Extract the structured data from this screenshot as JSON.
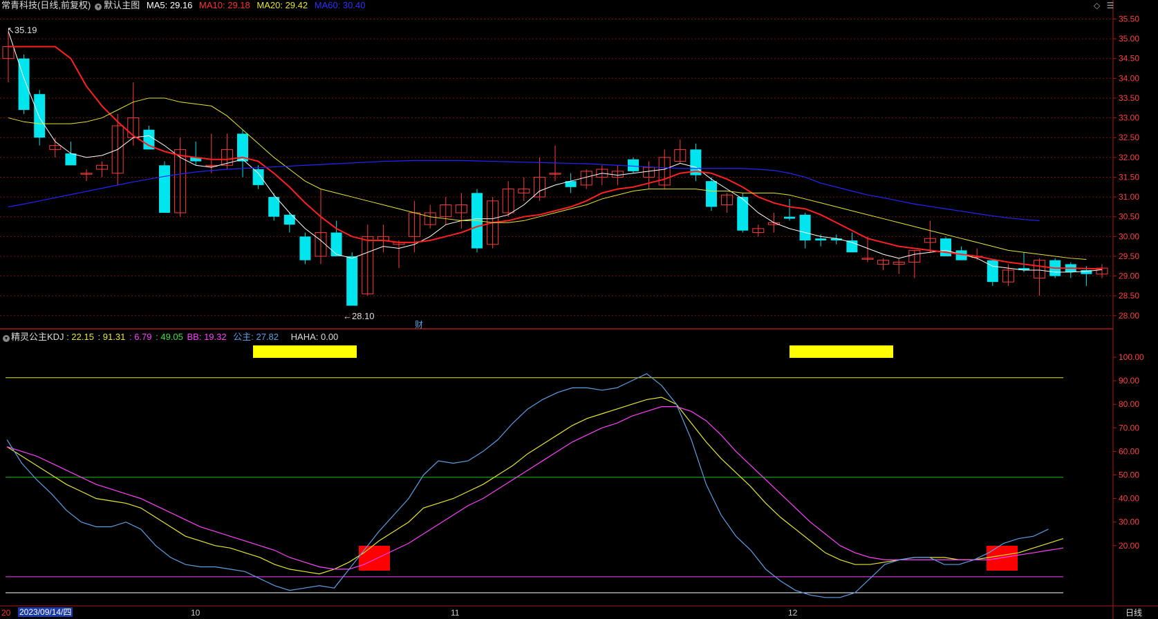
{
  "main_header": {
    "title": "常青科技(日线,前复权)",
    "layout": "默认主图",
    "ma5": "MA5: 29.16",
    "ma10": "MA10: 29.18",
    "ma20": "MA20: 29.42",
    "ma60": "MA60: 30.40"
  },
  "kdj_header": {
    "title": "精灵公主KDJ",
    "v1": ": 22.15",
    "v2": ": 91.31",
    "v3": ": 6.79",
    "v4": ": 49.05",
    "bb": "BB: 19.32",
    "gz": "公主: 27.82",
    "haha": "HAHA: 0.00"
  },
  "annotations": {
    "high": "35.19",
    "low": "28.10",
    "finance_marker": "财"
  },
  "date_axis": {
    "cursor_date": "2023/09/14/四",
    "left_label": "20",
    "months": [
      "10",
      "11",
      "12"
    ],
    "period": "日线"
  },
  "colors": {
    "bg": "#000000",
    "up": "#ff3b3b",
    "down": "#00e5ee",
    "ma5": "#ffffff",
    "ma10": "#ff2020",
    "ma20": "#e6e62e",
    "ma60": "#2424ff",
    "grid": "#7a1010",
    "k": "#e6e62e",
    "d": "#ff40ff",
    "j": "#5aa0e6"
  },
  "chart_data": [
    {
      "type": "candlestick",
      "title": "常青科技(日线,前复权)",
      "ylim": [
        27.7,
        35.7
      ],
      "y_ticks": [
        "35.50",
        "35.00",
        "34.50",
        "34.00",
        "33.50",
        "33.00",
        "32.50",
        "32.00",
        "31.50",
        "31.00",
        "30.50",
        "30.00",
        "29.50",
        "29.00",
        "28.50",
        "28.00"
      ],
      "candles": [
        {
          "o": 34.5,
          "h": 35.19,
          "l": 33.9,
          "c": 34.8
        },
        {
          "o": 34.5,
          "h": 34.6,
          "l": 33.1,
          "c": 33.2
        },
        {
          "o": 33.6,
          "h": 33.7,
          "l": 32.3,
          "c": 32.5
        },
        {
          "o": 32.2,
          "h": 32.5,
          "l": 32.0,
          "c": 32.3
        },
        {
          "o": 32.1,
          "h": 32.4,
          "l": 31.8,
          "c": 31.8
        },
        {
          "o": 31.6,
          "h": 31.7,
          "l": 31.4,
          "c": 31.6
        },
        {
          "o": 31.7,
          "h": 31.9,
          "l": 31.5,
          "c": 31.8
        },
        {
          "o": 31.6,
          "h": 33.1,
          "l": 31.3,
          "c": 32.8
        },
        {
          "o": 32.5,
          "h": 33.9,
          "l": 32.3,
          "c": 33.0
        },
        {
          "o": 32.7,
          "h": 32.8,
          "l": 32.2,
          "c": 32.2
        },
        {
          "o": 31.8,
          "h": 31.9,
          "l": 30.6,
          "c": 30.6
        },
        {
          "o": 30.6,
          "h": 32.5,
          "l": 30.5,
          "c": 32.2
        },
        {
          "o": 32.0,
          "h": 32.4,
          "l": 31.8,
          "c": 31.9
        },
        {
          "o": 31.8,
          "h": 32.6,
          "l": 31.6,
          "c": 31.8
        },
        {
          "o": 31.8,
          "h": 32.6,
          "l": 31.7,
          "c": 32.2
        },
        {
          "o": 32.6,
          "h": 32.7,
          "l": 31.5,
          "c": 31.9
        },
        {
          "o": 31.7,
          "h": 31.8,
          "l": 31.2,
          "c": 31.3
        },
        {
          "o": 31.0,
          "h": 31.1,
          "l": 30.4,
          "c": 30.5
        },
        {
          "o": 30.55,
          "h": 30.6,
          "l": 30.1,
          "c": 30.3
        },
        {
          "o": 30.0,
          "h": 30.1,
          "l": 29.3,
          "c": 29.4
        },
        {
          "o": 29.5,
          "h": 31.2,
          "l": 29.3,
          "c": 30.1
        },
        {
          "o": 30.1,
          "h": 30.4,
          "l": 29.5,
          "c": 29.5
        },
        {
          "o": 29.5,
          "h": 29.6,
          "l": 28.3,
          "c": 28.25
        },
        {
          "o": 28.55,
          "h": 30.3,
          "l": 28.5,
          "c": 30.0
        },
        {
          "o": 29.9,
          "h": 30.3,
          "l": 29.6,
          "c": 30.0
        },
        {
          "o": 29.8,
          "h": 29.9,
          "l": 29.2,
          "c": 29.85
        },
        {
          "o": 30.0,
          "h": 30.9,
          "l": 29.6,
          "c": 30.6
        },
        {
          "o": 30.3,
          "h": 30.8,
          "l": 30.2,
          "c": 30.6
        },
        {
          "o": 30.5,
          "h": 31.0,
          "l": 30.3,
          "c": 30.8
        },
        {
          "o": 30.6,
          "h": 31.1,
          "l": 30.2,
          "c": 30.8
        },
        {
          "o": 31.1,
          "h": 31.2,
          "l": 29.6,
          "c": 29.7
        },
        {
          "o": 29.8,
          "h": 31.0,
          "l": 29.7,
          "c": 30.9
        },
        {
          "o": 30.6,
          "h": 31.4,
          "l": 30.5,
          "c": 31.2
        },
        {
          "o": 31.1,
          "h": 31.5,
          "l": 30.9,
          "c": 31.2
        },
        {
          "o": 31.0,
          "h": 32.0,
          "l": 30.9,
          "c": 31.5
        },
        {
          "o": 31.6,
          "h": 32.3,
          "l": 31.4,
          "c": 31.6
        },
        {
          "o": 31.4,
          "h": 31.6,
          "l": 31.1,
          "c": 31.25
        },
        {
          "o": 31.3,
          "h": 31.7,
          "l": 31.2,
          "c": 31.65
        },
        {
          "o": 31.5,
          "h": 31.8,
          "l": 31.3,
          "c": 31.7
        },
        {
          "o": 31.5,
          "h": 31.8,
          "l": 31.3,
          "c": 31.65
        },
        {
          "o": 31.95,
          "h": 32.0,
          "l": 31.6,
          "c": 31.65
        },
        {
          "o": 31.5,
          "h": 31.9,
          "l": 31.2,
          "c": 31.75
        },
        {
          "o": 31.3,
          "h": 32.2,
          "l": 31.2,
          "c": 32.0
        },
        {
          "o": 31.9,
          "h": 32.45,
          "l": 31.85,
          "c": 32.2
        },
        {
          "o": 32.2,
          "h": 32.35,
          "l": 31.4,
          "c": 31.55
        },
        {
          "o": 31.4,
          "h": 31.5,
          "l": 30.65,
          "c": 30.75
        },
        {
          "o": 30.8,
          "h": 31.1,
          "l": 30.6,
          "c": 31.05
        },
        {
          "o": 31.0,
          "h": 31.1,
          "l": 30.1,
          "c": 30.15
        },
        {
          "o": 30.1,
          "h": 30.3,
          "l": 30.0,
          "c": 30.2
        },
        {
          "o": 30.3,
          "h": 30.6,
          "l": 30.1,
          "c": 30.35
        },
        {
          "o": 30.5,
          "h": 30.95,
          "l": 30.4,
          "c": 30.45
        },
        {
          "o": 30.55,
          "h": 30.6,
          "l": 29.7,
          "c": 29.9
        },
        {
          "o": 29.95,
          "h": 30.05,
          "l": 29.75,
          "c": 29.9
        },
        {
          "o": 29.95,
          "h": 30.05,
          "l": 29.8,
          "c": 29.9
        },
        {
          "o": 29.9,
          "h": 30.1,
          "l": 29.6,
          "c": 29.6
        },
        {
          "o": 29.45,
          "h": 30.0,
          "l": 29.35,
          "c": 29.45
        },
        {
          "o": 29.3,
          "h": 29.45,
          "l": 29.15,
          "c": 29.4
        },
        {
          "o": 29.3,
          "h": 29.45,
          "l": 29.05,
          "c": 29.35
        },
        {
          "o": 29.35,
          "h": 29.65,
          "l": 28.95,
          "c": 29.65
        },
        {
          "o": 29.85,
          "h": 30.4,
          "l": 29.6,
          "c": 29.95
        },
        {
          "o": 29.95,
          "h": 30.0,
          "l": 29.5,
          "c": 29.5
        },
        {
          "o": 29.65,
          "h": 29.75,
          "l": 29.4,
          "c": 29.4
        },
        {
          "o": 29.5,
          "h": 29.7,
          "l": 29.4,
          "c": 29.5
        },
        {
          "o": 29.4,
          "h": 29.4,
          "l": 28.75,
          "c": 28.85
        },
        {
          "o": 28.85,
          "h": 29.3,
          "l": 28.75,
          "c": 29.15
        },
        {
          "o": 29.2,
          "h": 29.6,
          "l": 29.1,
          "c": 29.15
        },
        {
          "o": 28.95,
          "h": 29.45,
          "l": 28.5,
          "c": 29.4
        },
        {
          "o": 29.4,
          "h": 29.45,
          "l": 28.95,
          "c": 29.0
        },
        {
          "o": 29.3,
          "h": 29.35,
          "l": 28.95,
          "c": 29.1
        },
        {
          "o": 29.15,
          "h": 29.25,
          "l": 28.75,
          "c": 29.05
        },
        {
          "o": 29.05,
          "h": 29.3,
          "l": 28.95,
          "c": 29.2
        }
      ],
      "ma_lines": {
        "ma5": [
          35.19,
          34.0,
          33.0,
          32.4,
          32.1,
          32.0,
          32.05,
          32.2,
          32.5,
          32.55,
          32.3,
          32.0,
          31.8,
          31.75,
          31.85,
          31.95,
          31.6,
          31.05,
          30.6,
          30.2,
          29.9,
          29.55,
          29.45,
          29.6,
          29.75,
          29.7,
          29.8,
          30.0,
          30.3,
          30.4,
          30.45,
          30.45,
          30.55,
          30.8,
          31.15,
          31.3,
          31.4,
          31.5,
          31.6,
          31.55,
          31.6,
          31.65,
          31.7,
          31.85,
          31.75,
          31.45,
          31.2,
          30.95,
          30.6,
          30.35,
          30.2,
          30.1,
          30.0,
          29.95,
          29.85,
          29.7,
          29.55,
          29.45,
          29.55,
          29.6,
          29.65,
          29.55,
          29.45,
          29.25,
          29.2,
          29.15,
          29.15,
          29.1,
          29.1,
          29.12,
          29.16
        ],
        "ma10": [
          34.8,
          34.8,
          34.8,
          34.8,
          34.5,
          33.8,
          33.3,
          32.9,
          32.55,
          32.3,
          32.15,
          32.05,
          32.0,
          31.95,
          31.95,
          32.0,
          31.9,
          31.6,
          31.25,
          30.85,
          30.5,
          30.2,
          30.0,
          29.9,
          29.9,
          29.85,
          29.85,
          29.9,
          30.0,
          30.1,
          30.25,
          30.35,
          30.4,
          30.5,
          30.55,
          30.65,
          30.75,
          30.9,
          31.1,
          31.2,
          31.25,
          31.35,
          31.45,
          31.6,
          31.65,
          31.6,
          31.45,
          31.25,
          31.0,
          30.85,
          30.75,
          30.7,
          30.55,
          30.35,
          30.15,
          29.95,
          29.85,
          29.75,
          29.7,
          29.65,
          29.6,
          29.55,
          29.5,
          29.42,
          29.35,
          29.3,
          29.25,
          29.2,
          29.2,
          29.19,
          29.18
        ],
        "ma20": [
          33.0,
          32.9,
          32.85,
          32.85,
          32.85,
          32.9,
          33.0,
          33.2,
          33.4,
          33.5,
          33.5,
          33.4,
          33.35,
          33.3,
          33.05,
          32.7,
          32.35,
          32.0,
          31.7,
          31.4,
          31.2,
          31.1,
          31.0,
          30.9,
          30.8,
          30.7,
          30.6,
          30.5,
          30.45,
          30.4,
          30.4,
          30.35,
          30.35,
          30.4,
          30.5,
          30.6,
          30.7,
          30.8,
          30.95,
          31.05,
          31.15,
          31.2,
          31.2,
          31.2,
          31.2,
          31.15,
          31.15,
          31.1,
          31.1,
          31.1,
          31.05,
          30.95,
          30.85,
          30.75,
          30.65,
          30.55,
          30.45,
          30.35,
          30.25,
          30.15,
          30.05,
          29.95,
          29.85,
          29.75,
          29.65,
          29.6,
          29.55,
          29.5,
          29.45,
          29.42
        ],
        "ma60": [
          30.75,
          30.82,
          30.9,
          30.98,
          31.06,
          31.14,
          31.22,
          31.3,
          31.38,
          31.45,
          31.52,
          31.58,
          31.63,
          31.67,
          31.7,
          31.72,
          31.74,
          31.76,
          31.78,
          31.8,
          31.82,
          31.84,
          31.86,
          31.88,
          31.9,
          31.91,
          31.92,
          31.92,
          31.92,
          31.92,
          31.91,
          31.9,
          31.89,
          31.88,
          31.87,
          31.86,
          31.85,
          31.84,
          31.82,
          31.8,
          31.78,
          31.76,
          31.74,
          31.72,
          31.72,
          31.72,
          31.72,
          31.72,
          31.7,
          31.67,
          31.6,
          31.5,
          31.35,
          31.25,
          31.15,
          31.05,
          30.98,
          30.9,
          30.82,
          30.76,
          30.7,
          30.64,
          30.58,
          30.52,
          30.47,
          30.43,
          30.4
        ]
      }
    },
    {
      "type": "line",
      "title": "精灵公主KDJ",
      "ylim": [
        0,
        105
      ],
      "y_ticks": [
        "100.00",
        "90.00",
        "80.00",
        "70.00",
        "60.00",
        "50.00",
        "40.00",
        "30.00",
        "20.00"
      ],
      "ref_lines": {
        "yellow": 91.3,
        "green": 49,
        "magenta": 6.8,
        "white": 0
      },
      "series": [
        {
          "name": "K",
          "values": [
            62,
            58,
            54,
            50,
            46,
            43,
            40,
            39,
            38,
            36,
            32,
            28,
            24,
            22,
            20,
            19,
            17,
            15,
            12,
            10,
            9,
            8,
            10,
            13,
            17,
            22,
            26,
            30,
            36,
            38,
            40,
            43,
            46,
            50,
            54,
            59,
            63,
            67,
            71,
            74,
            76,
            78,
            80,
            82,
            83,
            80,
            72,
            64,
            57,
            51,
            45,
            38,
            32,
            27,
            22,
            17,
            14,
            12,
            12,
            13,
            14,
            15,
            15,
            15,
            14,
            14,
            15,
            16,
            17,
            19,
            21,
            23
          ]
        },
        {
          "name": "D",
          "values": [
            62,
            60,
            58,
            55,
            52,
            49,
            46,
            44,
            42,
            40,
            37,
            34,
            31,
            28,
            26,
            24,
            22,
            20,
            18,
            15,
            13,
            11,
            10,
            10,
            12,
            15,
            18,
            21,
            25,
            29,
            33,
            37,
            40,
            44,
            48,
            52,
            56,
            60,
            64,
            67,
            70,
            72,
            75,
            77,
            79,
            79,
            77,
            73,
            67,
            60,
            54,
            48,
            42,
            36,
            30,
            25,
            20,
            17,
            15,
            14,
            14,
            14,
            14,
            14,
            14,
            14,
            14,
            15,
            16,
            17,
            18,
            19
          ]
        },
        {
          "name": "J",
          "values": [
            65,
            55,
            48,
            42,
            35,
            30,
            28,
            28,
            30,
            27,
            20,
            15,
            12,
            11,
            11,
            10,
            9,
            6,
            3,
            1,
            2,
            3,
            2,
            10,
            18,
            26,
            33,
            40,
            50,
            56,
            55,
            56,
            60,
            65,
            72,
            78,
            82,
            85,
            87,
            87,
            86,
            87,
            90,
            93,
            88,
            80,
            65,
            46,
            33,
            24,
            18,
            10,
            5,
            1,
            -1,
            -2,
            -2,
            0,
            6,
            12,
            14,
            15,
            15,
            12,
            12,
            14,
            17,
            21,
            23,
            24,
            27
          ]
        }
      ],
      "signals": {
        "yellow_bars": 2,
        "red_blocks": 2
      }
    }
  ]
}
